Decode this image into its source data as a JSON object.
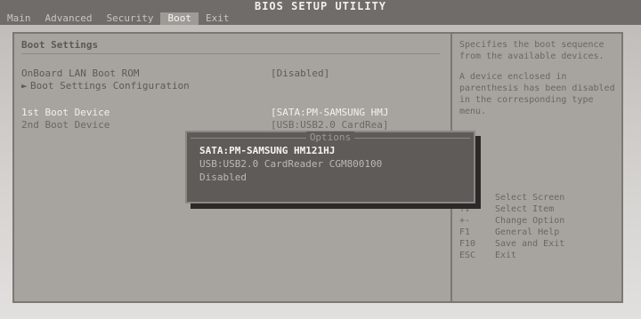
{
  "window": {
    "title": "BIOS SETUP UTILITY"
  },
  "menu": {
    "items": [
      {
        "label": "Main"
      },
      {
        "label": "Advanced"
      },
      {
        "label": "Security"
      },
      {
        "label": "Boot",
        "active": true
      },
      {
        "label": "Exit"
      }
    ]
  },
  "boot": {
    "heading": "Boot Settings",
    "onboard_lan_label": "OnBoard LAN Boot ROM",
    "onboard_lan_value": "[Disabled]",
    "boot_settings_config": "Boot Settings Configuration",
    "first_boot_label": "1st Boot Device",
    "first_boot_value": "[SATA:PM-SAMSUNG HMJ",
    "second_boot_label": "2nd Boot Device",
    "second_boot_value": "[USB:USB2.0 CardRea]"
  },
  "popup": {
    "title": "Options",
    "options": [
      "SATA:PM-SAMSUNG HM121HJ",
      "USB:USB2.0 CardReader CGM800100",
      "Disabled"
    ]
  },
  "help": {
    "paragraph1": "Specifies the boot sequence from the available devices.",
    "paragraph2": "A device enclosed in parenthesis has been disabled in the corresponding type menu."
  },
  "keys": [
    {
      "key": "",
      "desc": "Select Screen"
    },
    {
      "key": "↑↓",
      "desc": "Select Item"
    },
    {
      "key": "+-",
      "desc": "Change Option"
    },
    {
      "key": "F1",
      "desc": "General Help"
    },
    {
      "key": "F10",
      "desc": "Save and Exit"
    },
    {
      "key": "ESC",
      "desc": "Exit"
    }
  ],
  "colors": {
    "background": "#a7a4a0",
    "highlight_text": "#f2f0ed",
    "popup_bg": "#5e5b58"
  }
}
